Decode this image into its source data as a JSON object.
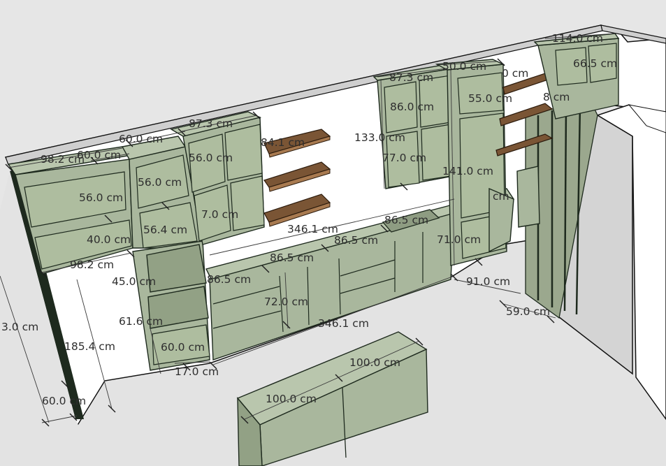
{
  "dimensions": [
    {
      "id": "d1",
      "text": "98.2 cm"
    },
    {
      "id": "d2",
      "text": "60.0 cm"
    },
    {
      "id": "d3",
      "text": "60.0 cm"
    },
    {
      "id": "d4",
      "text": "87.3 cm"
    },
    {
      "id": "d5",
      "text": "56.0 cm"
    },
    {
      "id": "d6",
      "text": "56.0 cm"
    },
    {
      "id": "d7",
      "text": "56.0 cm"
    },
    {
      "id": "d8",
      "text": "84.1 cm"
    },
    {
      "id": "d9",
      "text": "56.4 cm"
    },
    {
      "id": "d10",
      "text": "7.0 cm"
    },
    {
      "id": "d11",
      "text": "40.0 cm"
    },
    {
      "id": "d12",
      "text": "98.2 cm"
    },
    {
      "id": "d13",
      "text": "45.0 cm"
    },
    {
      "id": "d14",
      "text": "86.5 cm"
    },
    {
      "id": "d15",
      "text": "86.5 cm"
    },
    {
      "id": "d16",
      "text": "86.5 cm"
    },
    {
      "id": "d17",
      "text": "86.5 cm"
    },
    {
      "id": "d18",
      "text": "346.1 cm"
    },
    {
      "id": "d19",
      "text": "346.1 cm"
    },
    {
      "id": "d20",
      "text": "72.0 cm"
    },
    {
      "id": "d21",
      "text": "61.6 cm"
    },
    {
      "id": "d22",
      "text": "60.0 cm"
    },
    {
      "id": "d23",
      "text": "60.0 cm"
    },
    {
      "id": "d24",
      "text": "185.4 cm"
    },
    {
      "id": "d25",
      "text": "3.0 cm"
    },
    {
      "id": "d26",
      "text": "17.0 cm"
    },
    {
      "id": "d27",
      "text": "87.3 cm"
    },
    {
      "id": "d28",
      "text": "86.0 cm"
    },
    {
      "id": "d29",
      "text": "133.0 cm"
    },
    {
      "id": "d30",
      "text": "77.0 cm"
    },
    {
      "id": "d31",
      "text": "50.0 cm"
    },
    {
      "id": "d32",
      "text": "0 cm"
    },
    {
      "id": "d33",
      "text": "55.0 cm"
    },
    {
      "id": "d34",
      "text": "141.0 cm"
    },
    {
      "id": "d35",
      "text": "cm"
    },
    {
      "id": "d36",
      "text": "71.0 cm"
    },
    {
      "id": "d37",
      "text": "91.0 cm"
    },
    {
      "id": "d38",
      "text": "59.0 cm"
    },
    {
      "id": "d39",
      "text": "114.0 cm"
    },
    {
      "id": "d40",
      "text": "66.5 cm"
    },
    {
      "id": "d41",
      "text": "8 cm"
    },
    {
      "id": "d42",
      "text": "100.0 cm"
    },
    {
      "id": "d43",
      "text": "100.0 cm"
    }
  ]
}
